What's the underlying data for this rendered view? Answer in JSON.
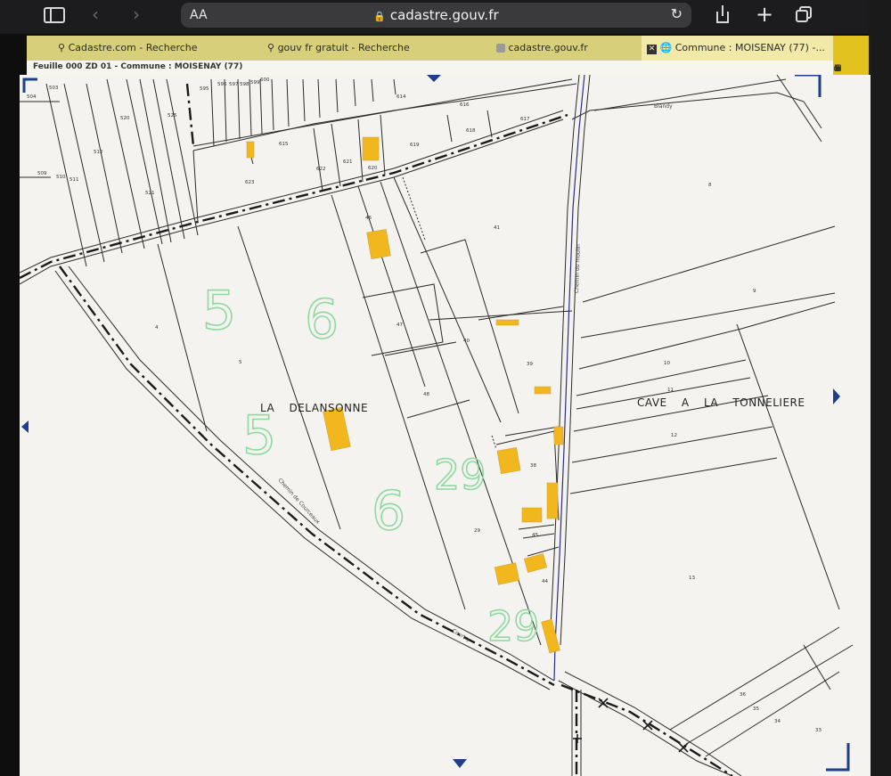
{
  "browser": {
    "aa_label": "AA",
    "url": "cadastre.gouv.fr",
    "tabs": [
      {
        "label": "Cadastre.com - Recherche",
        "icon": "search-icon"
      },
      {
        "label": "gouv fr gratuit - Recherche",
        "icon": "search-icon"
      },
      {
        "label": "cadastre.gouv.fr",
        "icon": "site-icon"
      },
      {
        "label": "Commune : MOISENAY (77) -...",
        "icon": "globe-icon",
        "active": true
      }
    ]
  },
  "sheet": {
    "title": "Feuille 000 ZD 01 - Commune : MOISENAY (77)"
  },
  "map": {
    "place_names": [
      "LA DELANSONNE",
      "CAVE A LA TONNELIERE"
    ],
    "roads": [
      "Blandy",
      "Chemin du moulin",
      "Chemin de Courceaux",
      "Courtry"
    ],
    "parcels": [
      "503",
      "504",
      "595",
      "596",
      "597",
      "598",
      "599",
      "600",
      "614",
      "616",
      "617",
      "520",
      "525",
      "512",
      "509",
      "510",
      "511",
      "521",
      "615",
      "618",
      "619",
      "620",
      "621",
      "622",
      "623",
      "46",
      "41",
      "8",
      "9",
      "47",
      "40",
      "39",
      "10",
      "11",
      "12",
      "13",
      "48",
      "38",
      "45",
      "44",
      "29",
      "36",
      "35",
      "34",
      "33",
      "4",
      "5"
    ],
    "handwritten": [
      "5",
      "6",
      "5",
      "6",
      "29",
      "29"
    ],
    "colors": {
      "building": "#f2b61f",
      "line": "#2a2a2a",
      "background": "#f4f3ef",
      "tab_bar": "#d8cf7a",
      "frame": "#e2c21e"
    }
  }
}
